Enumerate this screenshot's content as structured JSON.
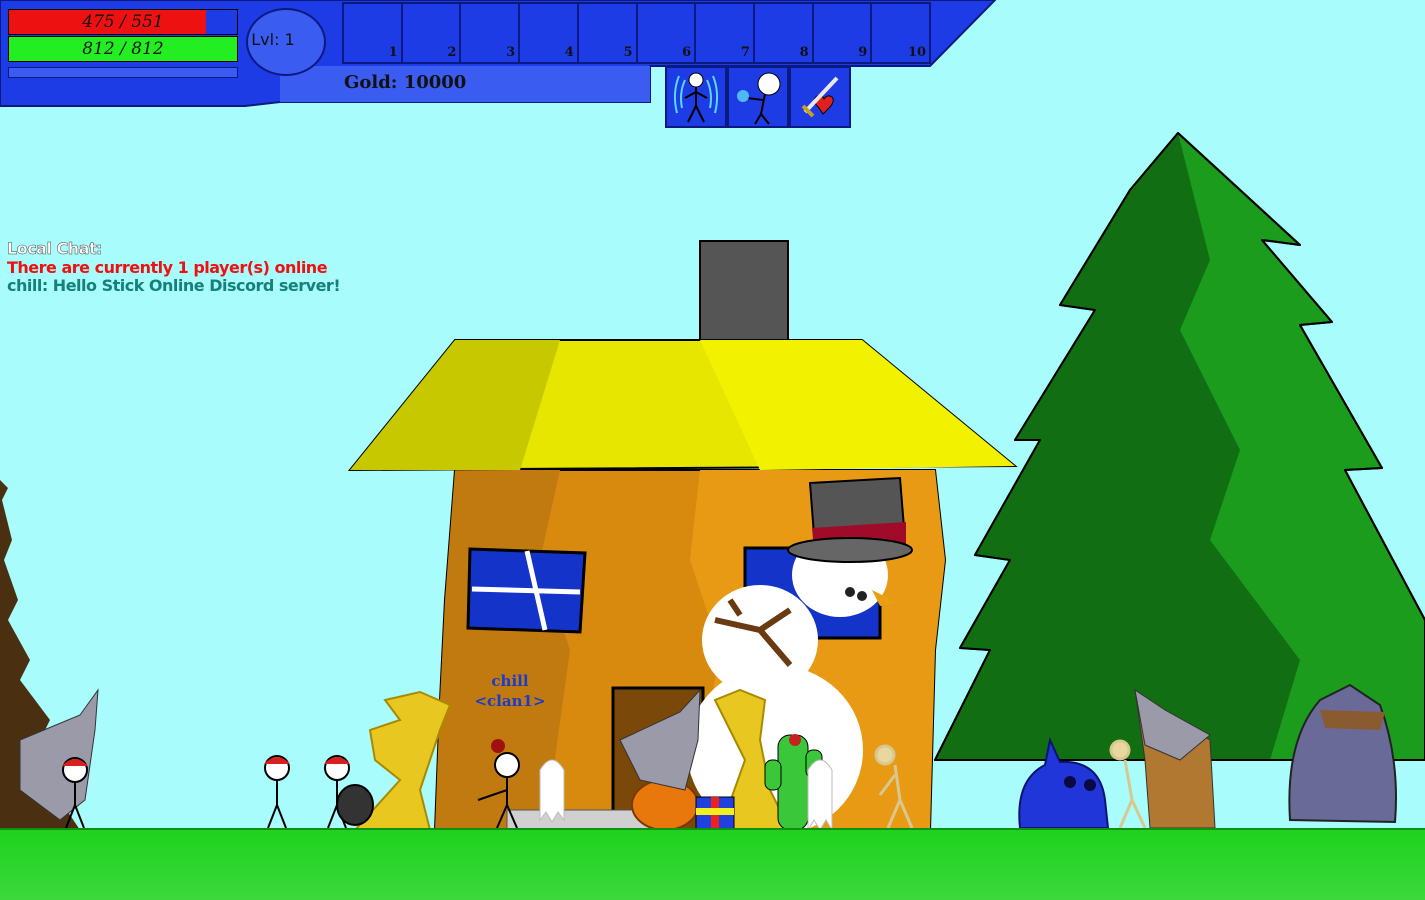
{
  "hud": {
    "health": {
      "current": 475,
      "max": 551,
      "text": "475 / 551",
      "color": "#ee1111"
    },
    "mana": {
      "current": 812,
      "max": 812,
      "text": "812 / 812",
      "color": "#22ee22"
    },
    "experience_fraction": 0.0,
    "level_text": "Lvl: 1",
    "gold_text": "Gold: 10000",
    "hotbar_slots": [
      "1",
      "2",
      "3",
      "4",
      "5",
      "6",
      "7",
      "8",
      "9",
      "10"
    ],
    "skills": [
      {
        "name": "aura-skill",
        "icon": "stickman-aura-icon"
      },
      {
        "name": "magic-skill",
        "icon": "stickman-magic-orb-icon"
      },
      {
        "name": "weapon-skill",
        "icon": "sword-heart-icon"
      }
    ],
    "panel_color": "#1e3ce6"
  },
  "chat": {
    "header": "Local Chat:",
    "lines": [
      {
        "text": "There are currently 1 player(s) online",
        "color": "#ee1111"
      },
      {
        "text": "chill: Hello Stick Online Discord server!",
        "color": "#17807a"
      }
    ]
  },
  "player": {
    "name": "chill",
    "clan": "<clan1>"
  },
  "colors": {
    "sky": "#a8fcfc",
    "grass": "#22c822",
    "roof": "#e6e600",
    "wall": "#e08c0c",
    "tree": "#1aa01a"
  }
}
